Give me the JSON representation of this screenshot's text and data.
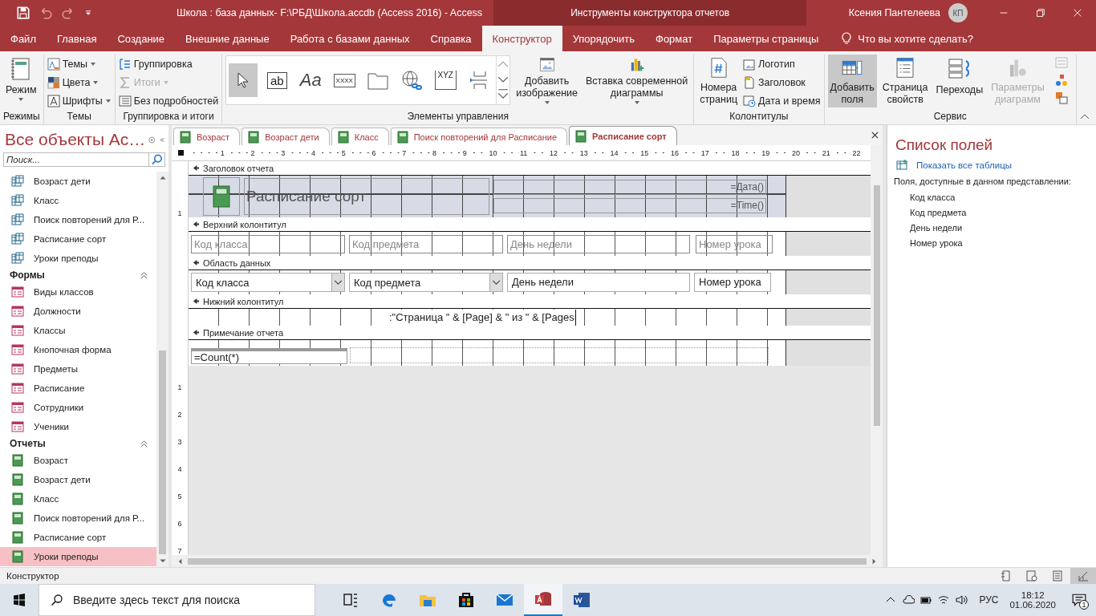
{
  "title_bar": {
    "title": "Школа : база данных- F:\\РБД\\Школа.accdb (Access 2016)  -  Access",
    "context_title": "Инструменты конструктора отчетов",
    "user_name": "Ксения Пантелеева",
    "user_initials": "КП"
  },
  "ribbon_tabs": [
    {
      "label": "Файл",
      "selected": false
    },
    {
      "label": "Главная",
      "selected": false
    },
    {
      "label": "Создание",
      "selected": false
    },
    {
      "label": "Внешние данные",
      "selected": false
    },
    {
      "label": "Работа с базами данных",
      "selected": false
    },
    {
      "label": "Справка",
      "selected": false
    },
    {
      "label": "Конструктор",
      "selected": true
    },
    {
      "label": "Упорядочить",
      "selected": false
    },
    {
      "label": "Формат",
      "selected": false
    },
    {
      "label": "Параметры страницы",
      "selected": false
    }
  ],
  "tell_me": "Что вы хотите сделать?",
  "ribbon_groups": [
    {
      "label": "Режимы",
      "large": [
        {
          "kind": "view",
          "lines": [
            "Режим"
          ],
          "dropdown": true,
          "selected": false,
          "disabled": false
        }
      ]
    },
    {
      "label": "Темы",
      "small": [
        {
          "kind": "themes",
          "label": "Темы",
          "dropdown": true,
          "disabled": false
        },
        {
          "kind": "colors",
          "label": "Цвета",
          "dropdown": true,
          "disabled": false
        },
        {
          "kind": "fonts",
          "label": "Шрифты",
          "dropdown": true,
          "disabled": false
        }
      ]
    },
    {
      "label": "Группировка и итоги",
      "small": [
        {
          "kind": "grouping",
          "label": "Группировка",
          "dropdown": false,
          "disabled": false
        },
        {
          "kind": "totals",
          "label": "Итоги",
          "dropdown": true,
          "disabled": true
        },
        {
          "kind": "hide-details",
          "label": "Без подробностей",
          "dropdown": false,
          "disabled": false
        }
      ]
    },
    {
      "label": "Элементы управления",
      "gallery": [
        {
          "kind": "pointer",
          "selected": true
        },
        {
          "kind": "textbox",
          "glyph": "ab",
          "selected": false
        },
        {
          "kind": "label",
          "glyph": "Aa",
          "selected": false
        },
        {
          "kind": "button",
          "glyph": "XXXX",
          "selected": false
        },
        {
          "kind": "tab",
          "selected": false
        },
        {
          "kind": "hyperlink",
          "selected": false
        },
        {
          "kind": "frame",
          "glyph": "XYZ",
          "selected": false
        },
        {
          "kind": "pagebreak",
          "selected": false
        }
      ],
      "large": [
        {
          "kind": "image",
          "lines": [
            "Добавить",
            "изображение"
          ],
          "dropdown": true,
          "selected": false,
          "disabled": false
        },
        {
          "kind": "chart",
          "lines": [
            "Вставка современной",
            "диаграммы"
          ],
          "dropdown": true,
          "selected": false,
          "disabled": false
        }
      ]
    },
    {
      "label": "Колонтитулы",
      "large": [
        {
          "kind": "page-numbers",
          "lines": [
            "Номера",
            "страниц"
          ],
          "dropdown": false,
          "selected": false,
          "disabled": false
        }
      ],
      "small": [
        {
          "kind": "logo",
          "label": "Логотип",
          "dropdown": false,
          "disabled": false
        },
        {
          "kind": "title",
          "label": "Заголовок",
          "dropdown": false,
          "disabled": false
        },
        {
          "kind": "datetime",
          "label": "Дата и время",
          "dropdown": false,
          "disabled": false
        }
      ]
    },
    {
      "label": "Сервис",
      "large": [
        {
          "kind": "add-fields",
          "lines": [
            "Добавить",
            "поля"
          ],
          "dropdown": false,
          "selected": true,
          "disabled": false
        },
        {
          "kind": "property-sheet",
          "lines": [
            "Страница",
            "свойств"
          ],
          "dropdown": false,
          "selected": false,
          "disabled": false
        },
        {
          "kind": "tab-order",
          "lines": [
            "Переходы"
          ],
          "dropdown": false,
          "selected": false,
          "disabled": false
        },
        {
          "kind": "chart-settings",
          "lines": [
            "Параметры",
            "диаграмм"
          ],
          "dropdown": false,
          "selected": false,
          "disabled": true
        }
      ],
      "icons": [
        {
          "kind": "subform",
          "disabled": true
        },
        {
          "kind": "code",
          "disabled": false
        },
        {
          "kind": "convert",
          "disabled": false
        }
      ]
    }
  ],
  "nav_pane": {
    "title": "Все объекты Ac…",
    "search_placeholder": "Поиск...",
    "groups": [
      {
        "kind": "query",
        "items": [
          {
            "label": "Возраст дети",
            "selected": false
          },
          {
            "label": "Класс",
            "selected": false
          },
          {
            "label": "Поиск повторений для Р...",
            "selected": false
          },
          {
            "label": "Расписание сорт",
            "selected": false
          },
          {
            "label": "Уроки преподы",
            "selected": false
          }
        ]
      },
      {
        "kind": "form",
        "label": "Формы",
        "expanded": true,
        "items": [
          {
            "label": "Виды классов",
            "selected": false
          },
          {
            "label": "Должности",
            "selected": false
          },
          {
            "label": "Классы",
            "selected": false
          },
          {
            "label": "Кнопочная форма",
            "selected": false
          },
          {
            "label": "Предметы",
            "selected": false
          },
          {
            "label": "Расписание",
            "selected": false
          },
          {
            "label": "Сотрудники",
            "selected": false
          },
          {
            "label": "Ученики",
            "selected": false
          }
        ]
      },
      {
        "kind": "report",
        "label": "Отчеты",
        "expanded": true,
        "items": [
          {
            "label": "Возраст",
            "selected": false
          },
          {
            "label": "Возраст дети",
            "selected": false
          },
          {
            "label": "Класс",
            "selected": false
          },
          {
            "label": "Поиск повторений для Р...",
            "selected": false
          },
          {
            "label": "Расписание сорт",
            "selected": false
          },
          {
            "label": "Уроки преподы",
            "selected": true
          }
        ]
      }
    ]
  },
  "document_tabs": [
    {
      "label": "Возраст",
      "selected": false
    },
    {
      "label": "Возраст дети",
      "selected": false
    },
    {
      "label": "Класс",
      "selected": false
    },
    {
      "label": "Поиск повторений для Расписание",
      "selected": false
    },
    {
      "label": "Расписание сорт",
      "selected": true
    }
  ],
  "ruler_marks": [
    "1",
    "2",
    "3",
    "4",
    "5",
    "6",
    "7",
    "8",
    "9",
    "10",
    "11",
    "12",
    "13",
    "14",
    "15",
    "16",
    "17",
    "18",
    "19",
    "20",
    "21",
    "22"
  ],
  "sections": [
    {
      "kind": "report-header",
      "title": "Заголовок отчета",
      "ruler_mark": "1",
      "controls": [
        {
          "kind": "logo"
        },
        {
          "kind": "title",
          "text": "Расписание сорт"
        },
        {
          "kind": "expressions",
          "lines": [
            "=Дата()",
            "=Time()"
          ]
        }
      ]
    },
    {
      "kind": "page-header",
      "title": "Верхний колонтитул",
      "controls": [
        {
          "kind": "label",
          "text": "Код класса"
        },
        {
          "kind": "label",
          "text": "Код предмета"
        },
        {
          "kind": "label",
          "text": "День недели"
        },
        {
          "kind": "label",
          "text": "Номер урока"
        }
      ]
    },
    {
      "kind": "detail",
      "title": "Область данных",
      "controls": [
        {
          "kind": "combo",
          "text": "Код класса"
        },
        {
          "kind": "combo",
          "text": "Код предмета"
        },
        {
          "kind": "textbox",
          "text": "День недели"
        },
        {
          "kind": "textbox",
          "text": "Номер урока"
        }
      ]
    },
    {
      "kind": "page-footer",
      "title": "Нижний колонтитул",
      "controls": [
        {
          "kind": "expression",
          "text": ":\"Страница \" & [Page] & \" из \" & [Pages"
        }
      ]
    },
    {
      "kind": "report-footer",
      "title": "Примечание отчета",
      "controls": [
        {
          "kind": "total",
          "text": "=Count(*)"
        }
      ]
    }
  ],
  "vertical_ruler_marks": [
    "1",
    "2",
    "3",
    "4",
    "5",
    "6",
    "7"
  ],
  "field_list": {
    "title": "Список полей",
    "show_all_link": "Показать все таблицы",
    "caption": "Поля, доступные в данном представлении:",
    "fields": [
      "Код класса",
      "Код предмета",
      "День недели",
      "Номер урока"
    ]
  },
  "status_bar": {
    "text": "Конструктор"
  },
  "taskbar": {
    "search_placeholder": "Введите здесь текст для поиска",
    "apps": [
      {
        "kind": "task-view",
        "active": false
      },
      {
        "kind": "edge",
        "active": false
      },
      {
        "kind": "explorer",
        "active": false
      },
      {
        "kind": "store",
        "active": false
      },
      {
        "kind": "mail",
        "active": false
      },
      {
        "kind": "access",
        "active": true
      },
      {
        "kind": "word",
        "active": false
      }
    ],
    "language": "РУС",
    "time": "18:12",
    "date": "01.06.2020",
    "notifications": "1"
  }
}
